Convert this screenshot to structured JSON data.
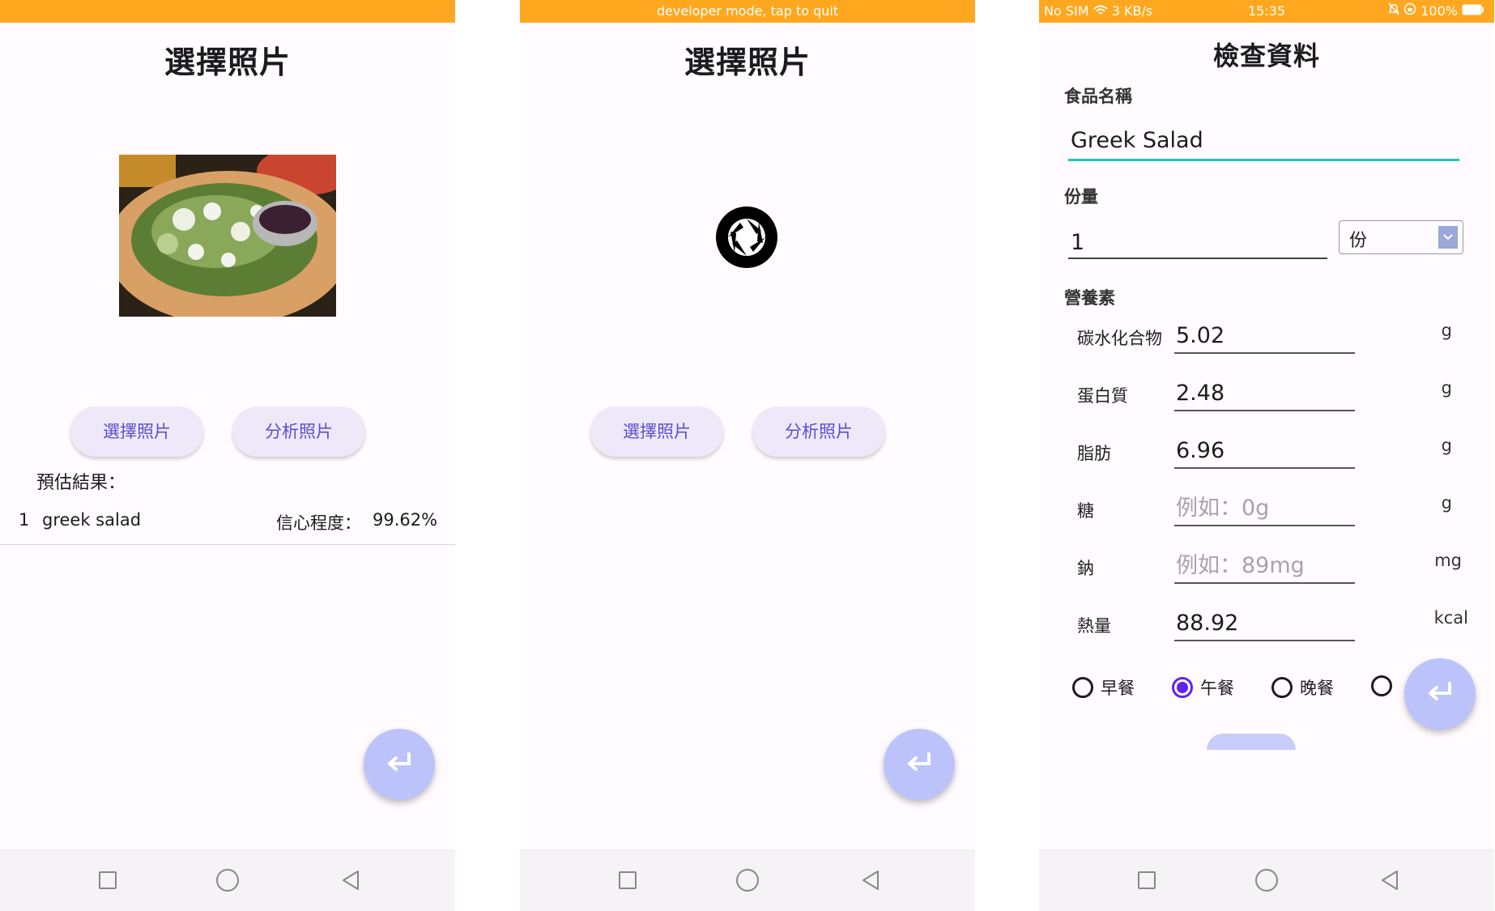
{
  "panel1": {
    "title": "選擇照片",
    "buttons": {
      "choose": "選擇照片",
      "analyze": "分析照片"
    },
    "result_label": "預估結果：",
    "results": [
      {
        "index": "1",
        "name": "greek salad",
        "confidence_label": "信心程度：",
        "confidence": "99.62%"
      }
    ]
  },
  "panel2": {
    "status_text": "developer mode, tap to quit",
    "title": "選擇照片",
    "buttons": {
      "choose": "選擇照片",
      "analyze": "分析照片"
    },
    "loading_icon": "camera-shutter-icon"
  },
  "panel3": {
    "status": {
      "carrier": "No SIM",
      "speed": "3 KB/s",
      "time": "15:35",
      "battery": "100%"
    },
    "title": "檢查資料",
    "food_name_label": "食品名稱",
    "food_name_value": "Greek Salad",
    "portion_label": "份量",
    "portion_value": "1",
    "portion_unit": "份",
    "nutrients_label": "營養素",
    "nutrients": [
      {
        "label": "碳水化合物",
        "value": "5.02",
        "placeholder": "",
        "unit": "g"
      },
      {
        "label": "蛋白質",
        "value": "2.48",
        "placeholder": "",
        "unit": "g"
      },
      {
        "label": "脂肪",
        "value": "6.96",
        "placeholder": "",
        "unit": "g"
      },
      {
        "label": "糖",
        "value": "",
        "placeholder": "例如：0g",
        "unit": "g"
      },
      {
        "label": "鈉",
        "value": "",
        "placeholder": "例如：89mg",
        "unit": "mg"
      },
      {
        "label": "熱量",
        "value": "88.92",
        "placeholder": "",
        "unit": "kcal"
      }
    ],
    "meals": [
      {
        "label": "早餐",
        "selected": false
      },
      {
        "label": "午餐",
        "selected": true
      },
      {
        "label": "晚餐",
        "selected": false
      }
    ]
  },
  "colors": {
    "status_bar": "#ffa71f",
    "accent": "#6123e9",
    "fab": "#bcc3fb",
    "field_focus": "#1ec8b8",
    "pill_bg": "#efe8f9",
    "pill_text": "#5b4fcf"
  }
}
